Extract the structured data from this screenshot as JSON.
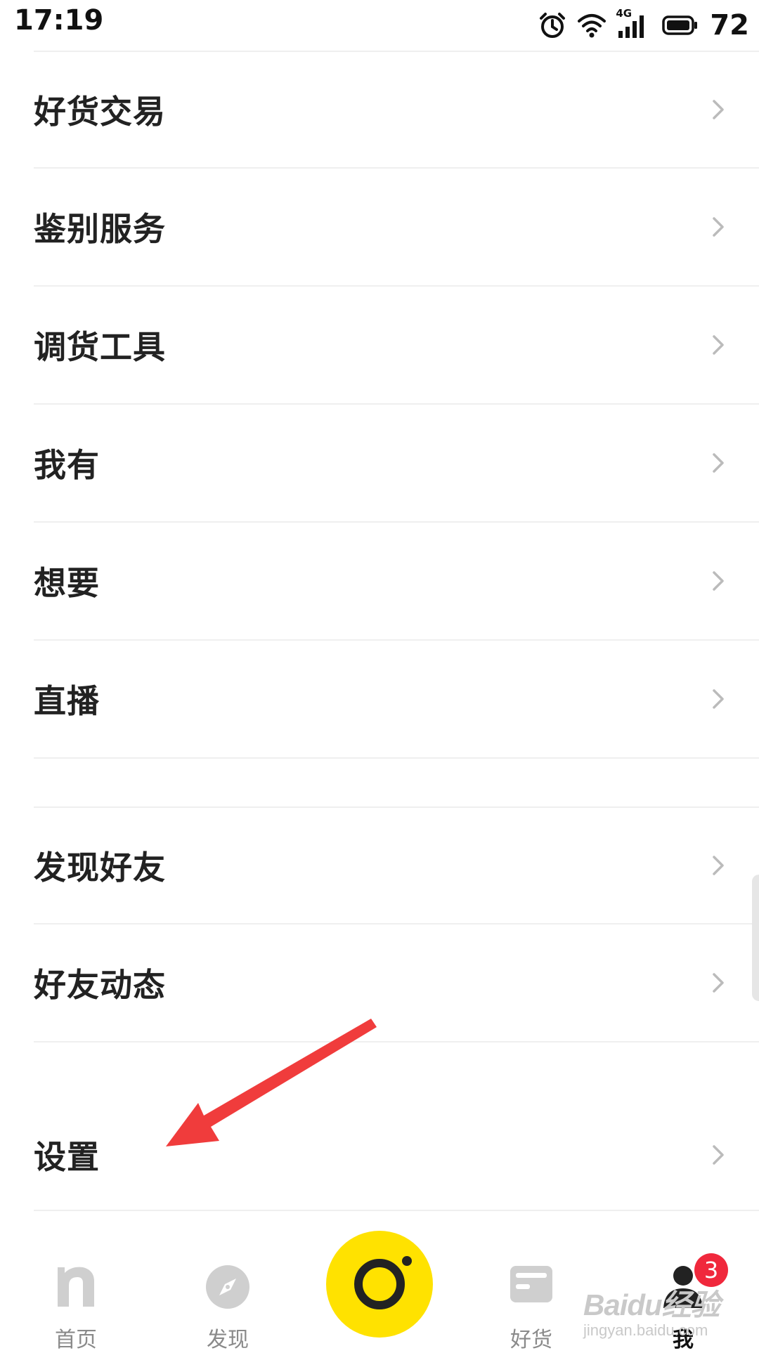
{
  "status_bar": {
    "time": "17:19",
    "network": "4G",
    "battery": "72",
    "icons": [
      "alarm-icon",
      "wifi-icon",
      "signal-icon",
      "battery-icon"
    ]
  },
  "menu": {
    "items": [
      {
        "label": "好货交易",
        "icon": "chevron-right-icon"
      },
      {
        "label": "鉴别服务",
        "icon": "chevron-right-icon"
      },
      {
        "label": "调货工具",
        "icon": "chevron-right-icon"
      },
      {
        "label": "我有",
        "icon": "chevron-right-icon"
      },
      {
        "label": "想要",
        "icon": "chevron-right-icon"
      },
      {
        "label": "直播",
        "icon": "chevron-right-icon"
      },
      {
        "label": "发现好友",
        "icon": "chevron-right-icon"
      },
      {
        "label": "好友动态",
        "icon": "chevron-right-icon"
      },
      {
        "label": "设置",
        "icon": "chevron-right-icon"
      }
    ]
  },
  "bottom_nav": {
    "items": [
      {
        "label": "首页",
        "icon": "home-n-icon"
      },
      {
        "label": "发现",
        "icon": "compass-icon"
      },
      {
        "label": "",
        "icon": "camera-icon"
      },
      {
        "label": "好货",
        "icon": "wallet-icon"
      },
      {
        "label": "我",
        "icon": "profile-icon",
        "active": true
      }
    ],
    "badge_count": "3"
  },
  "watermark": {
    "main": "Baidu经验",
    "sub": "jingyan.baidu.com"
  },
  "colors": {
    "accent_yellow": "#ffe200",
    "badge_red": "#f0283c",
    "arrow_red": "#f03c3c",
    "text_dark": "#222222",
    "nav_gray": "#8a8a8a",
    "divider": "#efefef"
  }
}
